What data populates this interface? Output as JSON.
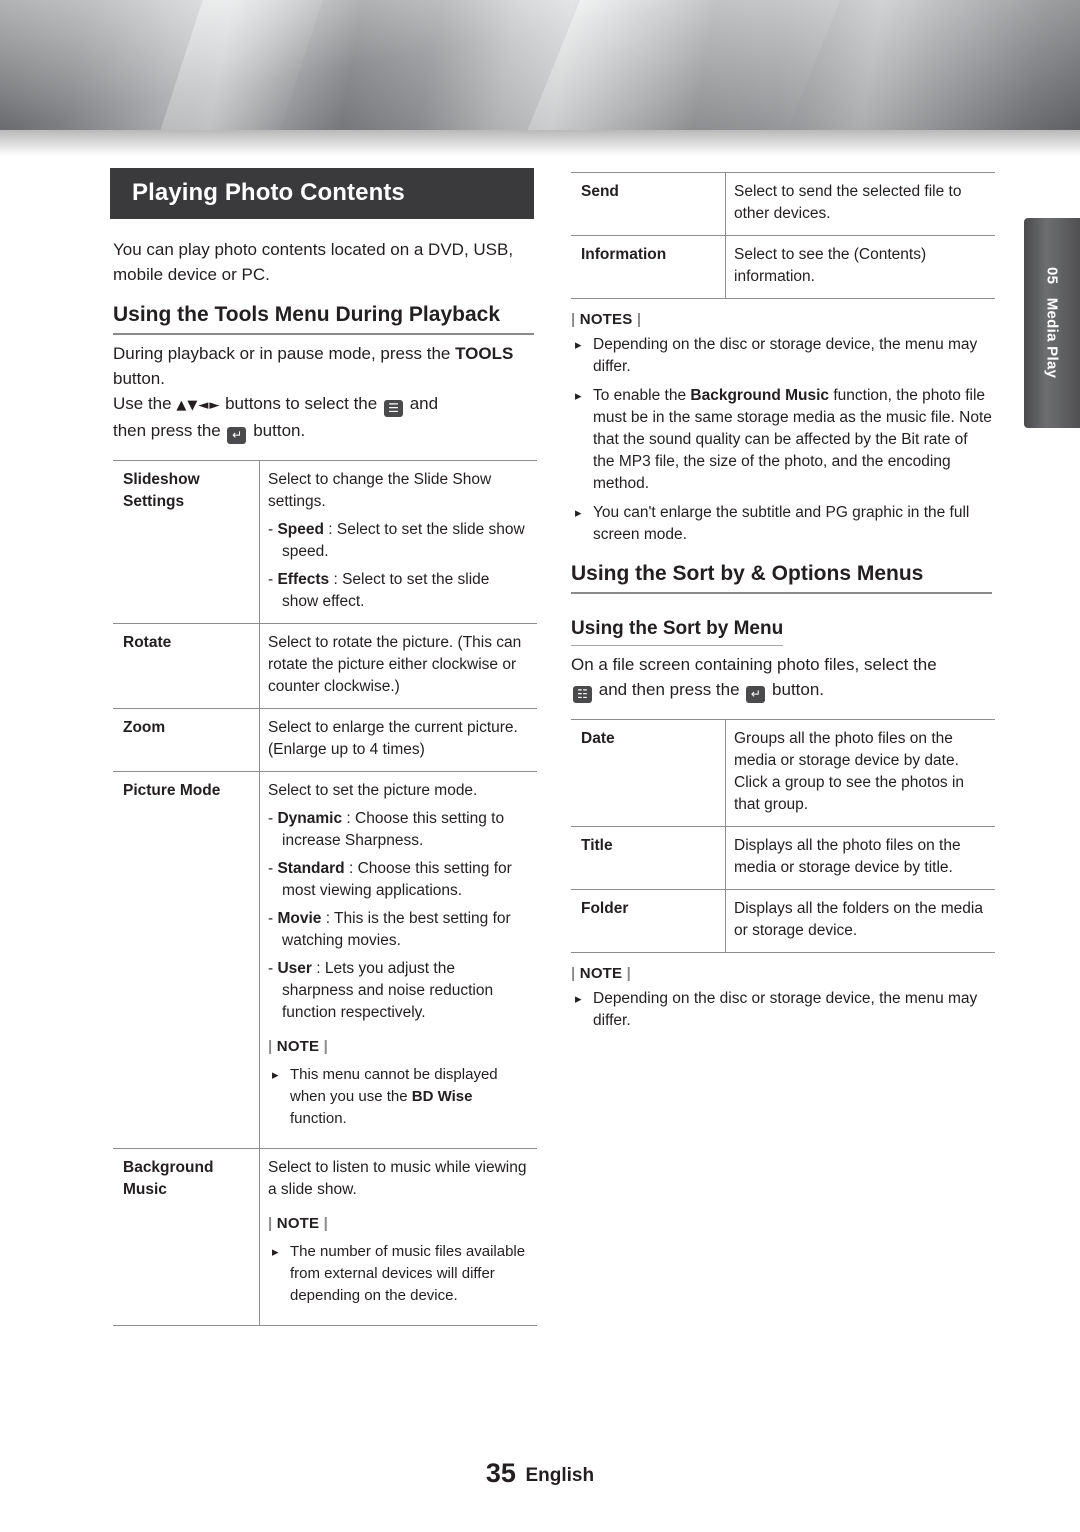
{
  "page": {
    "number": "35",
    "language": "English"
  },
  "side_tab": {
    "number": "05",
    "label": "Media Play"
  },
  "left": {
    "chapter_title": "Playing Photo Contents",
    "intro": "You can play photo contents located on a DVD, USB, mobile device or PC.",
    "section_title": "Using the Tools Menu During Playback",
    "instruction_1": "During playback or in pause mode, press the",
    "instruction_1_bold": "TOOLS",
    "instruction_1_end": "button.",
    "instruction_2_start": "Use the",
    "instruction_2_arrows": "▲▼◄►",
    "instruction_2_mid": "buttons to select the",
    "instruction_2_and": "and",
    "instruction_3_start": "then press the",
    "instruction_3_end": "button.",
    "table": [
      {
        "key": "Slideshow Settings",
        "lines": [
          "Select to change the Slide Show settings."
        ],
        "dashes": [
          {
            "term": "Speed",
            "text": " : Select to set the slide show speed."
          },
          {
            "term": "Effects",
            "text": " : Select to set the slide show effect."
          }
        ]
      },
      {
        "key": "Rotate",
        "lines": [
          "Select to rotate the picture. (This can rotate the picture either clockwise or counter clockwise.)"
        ],
        "dashes": []
      },
      {
        "key": "Zoom",
        "lines": [
          "Select to enlarge the current picture. (Enlarge up to 4 times)"
        ],
        "dashes": []
      },
      {
        "key": "Picture Mode",
        "lines": [
          "Select to set the picture mode."
        ],
        "dashes": [
          {
            "term": "Dynamic",
            "text": " : Choose this setting to increase Sharpness."
          },
          {
            "term": "Standard",
            "text": " : Choose this setting for most viewing applications."
          },
          {
            "term": "Movie",
            "text": " : This is the best setting for watching movies."
          },
          {
            "term": "User",
            "text": " : Lets you adjust the sharpness and noise reduction function respectively."
          }
        ],
        "note_label": "NOTE",
        "notes": [
          {
            "pre": "This menu cannot be displayed when you use the ",
            "bold": "BD Wise",
            "post": " function."
          }
        ]
      },
      {
        "key": "Background Music",
        "lines": [
          "Select to listen to music while viewing a slide show."
        ],
        "dashes": [],
        "note_label": "NOTE",
        "notes": [
          {
            "pre": "The number of music files available from external devices will differ depending on the device.",
            "bold": "",
            "post": ""
          }
        ]
      }
    ]
  },
  "right": {
    "table_top": [
      {
        "key": "Send",
        "value": "Select to send the selected file to other devices."
      },
      {
        "key": "Information",
        "value": "Select to see the (Contents) information."
      }
    ],
    "notes_label": "NOTES",
    "notes": [
      {
        "segments": [
          {
            "t": "Depending on the disc or storage device, the menu may differ.",
            "b": false
          }
        ]
      },
      {
        "segments": [
          {
            "t": "To enable the ",
            "b": false
          },
          {
            "t": "Background Music",
            "b": true
          },
          {
            "t": " function, the photo file must be in the same storage media as the music file. Note that the sound quality can be affected by the Bit rate of the MP3 file, the size of the photo, and the encoding method.",
            "b": false
          }
        ]
      },
      {
        "segments": [
          {
            "t": "You can't enlarge the subtitle and PG graphic in the full screen mode.",
            "b": false
          }
        ]
      }
    ],
    "section_title": "Using the Sort by & Options Menus",
    "sub_title": "Using the Sort by Menu",
    "instruction_start": "On a file screen containing photo files, select the",
    "instruction_mid": "and then press the",
    "instruction_end": "button.",
    "table_bottom": [
      {
        "key": "Date",
        "value": "Groups all the photo files on the media or storage device by date. Click a group to see the photos in that group."
      },
      {
        "key": "Title",
        "value": "Displays all the photo files on the media or storage device by title."
      },
      {
        "key": "Folder",
        "value": "Displays all the folders on the media or storage device."
      }
    ],
    "note_label": "NOTE",
    "note_items": [
      "Depending on the disc or storage device, the menu may differ."
    ]
  }
}
